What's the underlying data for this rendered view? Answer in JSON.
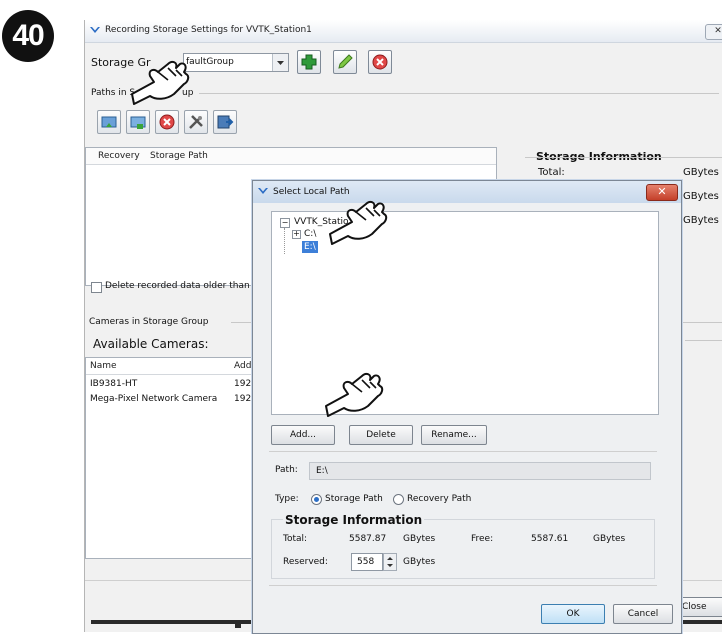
{
  "step_number": "40",
  "main_window": {
    "title": "Recording Storage Settings for VVTK_Station1",
    "close_glyph": "✕",
    "storage_group_label": "Storage Gr",
    "storage_group_value": "faultGroup",
    "paths_group_label_start": "Paths in S",
    "paths_group_label_end": "up",
    "paths_table": {
      "columns": [
        "Recovery",
        "Storage Path"
      ]
    },
    "storage_info": {
      "title": "Storage Information",
      "total_label": "Total:",
      "unit": "GBytes"
    },
    "delete_older_label": "Delete recorded data older than",
    "cameras_group_label": "Cameras in Storage Group",
    "available_cameras_label": "Available Cameras:",
    "camera_columns": [
      "Name",
      "Addr"
    ],
    "cameras": [
      {
        "name": "IB9381-HT",
        "address": "192."
      },
      {
        "name": "Mega-Pixel Network Camera",
        "address": "192."
      }
    ],
    "close_button": "Close"
  },
  "dialog": {
    "title": "Select Local Path",
    "close_glyph": "✕",
    "tree": {
      "root": "VVTK_Statio",
      "children": [
        {
          "label": "C:\\",
          "expander": "+"
        },
        {
          "label": "E:\\",
          "selected": true
        }
      ],
      "root_expander": "−"
    },
    "buttons": {
      "add": "Add...",
      "delete": "Delete",
      "rename": "Rename..."
    },
    "path_label": "Path:",
    "path_value": "E:\\",
    "type_label": "Type:",
    "type_options": [
      "Storage Path",
      "Recovery Path"
    ],
    "type_selected": "Storage Path",
    "storage_info": {
      "title": "Storage Information",
      "total_label": "Total:",
      "total_value": "5587.87",
      "free_label": "Free:",
      "free_value": "5587.61",
      "unit": "GBytes",
      "reserved_label": "Reserved:",
      "reserved_value": "558"
    },
    "ok": "OK",
    "cancel": "Cancel"
  }
}
